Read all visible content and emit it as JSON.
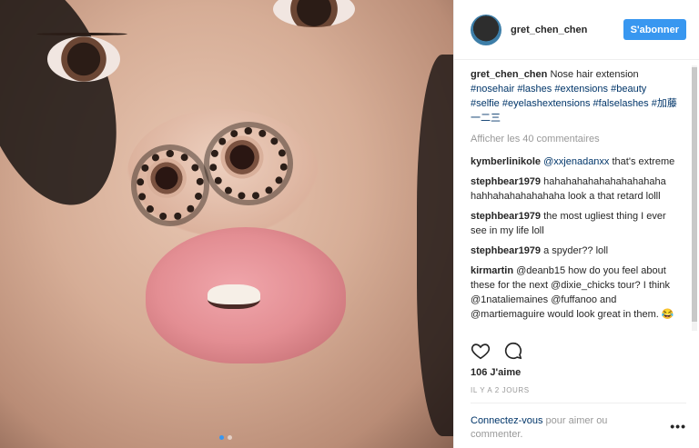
{
  "post": {
    "username": "gret_chen_chen",
    "follow_label": "S'abonner",
    "caption_user": "gret_chen_chen",
    "caption_text": "Nose hair extension",
    "hashtags": "#nosehair #lashes #extensions #beauty #selfie #eyelashextensions #falselashes #加藤一二三",
    "view_all": "Afficher les 40 commentaires",
    "likes": "106 J'aime",
    "time": "IL Y A 2 JOURS",
    "login_link": "Connectez-vous",
    "login_text": " pour aimer ou commenter.",
    "more": "•••",
    "carousel_active": 1,
    "carousel_total": 2
  },
  "comments": [
    {
      "user": "kymberlinikole",
      "mention": "@xxjenadanxx",
      "text": " that's extreme"
    },
    {
      "user": "stephbear1979",
      "text": "hahahahahahahahahahaha hahhahahahahahaha look a that retard lolll"
    },
    {
      "user": "stephbear1979",
      "text": "the most ugliest thing I ever see in my life loll"
    },
    {
      "user": "stephbear1979",
      "text": "a spyder?? loll"
    },
    {
      "user": "kirmartin",
      "text": "@deanb15 how do you feel about these for the next @dixie_chicks tour? I think @1nataliemaines @fuffanoo and @martiemaguire would look great in them. 😂"
    }
  ],
  "colors": {
    "accent": "#3897f0",
    "link": "#003569",
    "muted": "#999999"
  },
  "icons": {
    "like": "heart-outline-icon",
    "comment": "comment-bubble-icon",
    "more": "more-dots-icon"
  }
}
